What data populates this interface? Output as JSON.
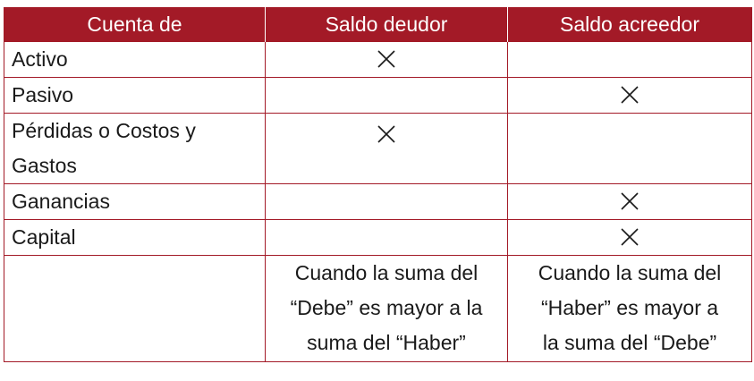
{
  "header": {
    "col1": "Cuenta de",
    "col2": "Saldo deudor",
    "col3": "Saldo acreedor"
  },
  "rows": [
    {
      "cuenta": "Activo",
      "deudor": true,
      "acreedor": false
    },
    {
      "cuenta": "Pasivo",
      "deudor": false,
      "acreedor": true
    },
    {
      "cuenta_line1": "Pérdidas o Costos y",
      "cuenta_line2": "Gastos",
      "deudor": true,
      "acreedor": false
    },
    {
      "cuenta": "Ganancias",
      "deudor": false,
      "acreedor": true
    },
    {
      "cuenta": "Capital",
      "deudor": false,
      "acreedor": true
    }
  ],
  "notes": {
    "deudor_line1": "Cuando la suma del",
    "deudor_line2": "“Debe” es mayor a la",
    "deudor_line3": "suma del “Haber”",
    "acreedor_line1": "Cuando la suma del",
    "acreedor_line2": "“Haber” es mayor a",
    "acreedor_line3": "la suma del “Debe”"
  },
  "colors": {
    "header_bg": "#a31a27",
    "border": "#a31a27",
    "header_text": "#ffffff"
  },
  "icons": {
    "mark": "x-mark-icon"
  }
}
